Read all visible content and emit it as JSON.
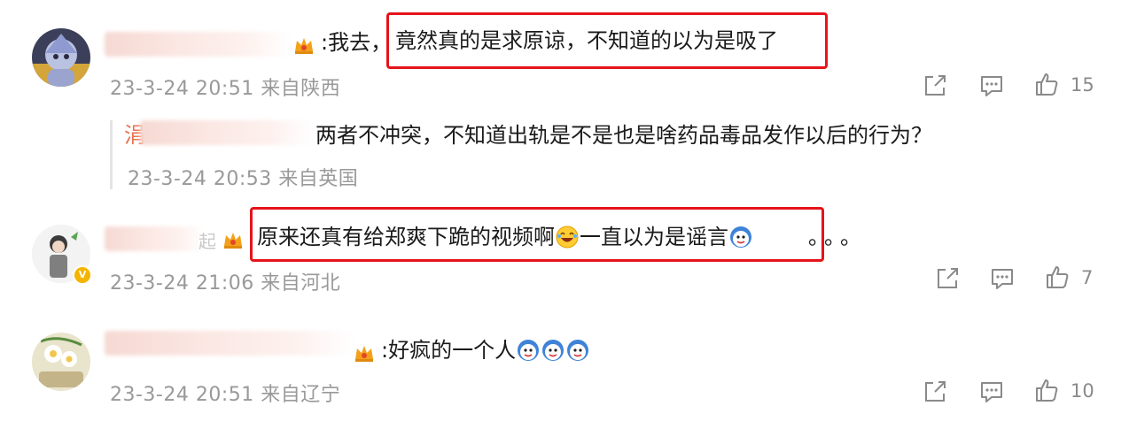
{
  "comments": [
    {
      "prefix": ":我去，",
      "highlighted": "竟然真的是求原谅，不知道的以为是吸了",
      "timestamp": "23-3-24 20:51 来自陕西",
      "likes": "15"
    },
    {
      "reply_name_fragment": "涓",
      "text": "两者不冲突，不知道出轨是不是也是啥药品毒品发作以后的行为？",
      "timestamp": "23-3-24 20:53 来自英国"
    },
    {
      "highlighted_a": "原来还真有给郑爽下跪的视频啊",
      "highlighted_b": "一直以为是谣言",
      "suffix": "。。。",
      "name_fragment": "起",
      "timestamp": "23-3-24 21:06 来自河北",
      "likes": "7"
    },
    {
      "text": ":好疯的一个人",
      "timestamp": "23-3-24 20:51 来自辽宁",
      "likes": "10"
    }
  ],
  "icons": {
    "share": "share-icon",
    "comment": "comment-icon",
    "like": "thumbs-up-icon",
    "vip_crown": "vip-crown-icon",
    "verified": "verified-badge-icon"
  },
  "colors": {
    "highlight_border": "#e5141a",
    "meta_text": "#999999",
    "crown": "#f4a11a"
  }
}
